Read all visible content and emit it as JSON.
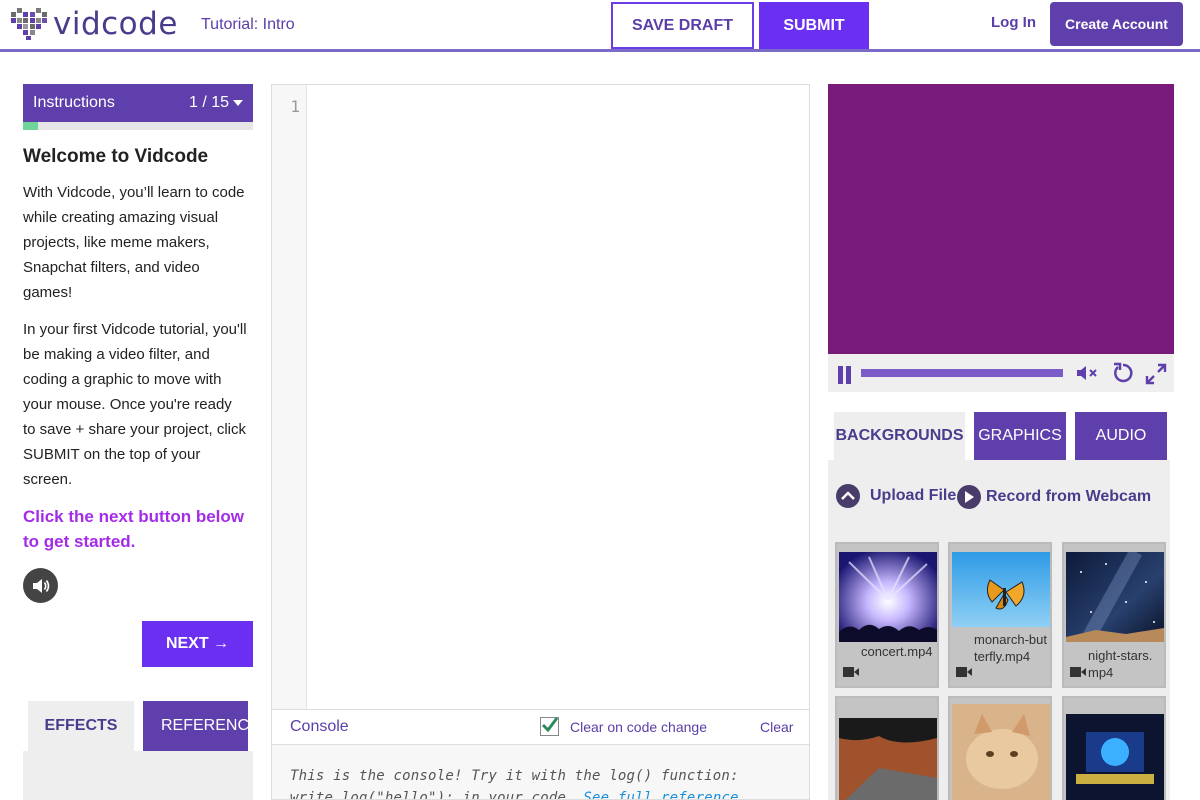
{
  "header": {
    "logo_text": "vidcode",
    "tutorial_title": "Tutorial: Intro",
    "save_draft_label": "SAVE DRAFT",
    "submit_label": "SUBMIT",
    "login_label": "Log In",
    "create_account_label": "Create Account"
  },
  "instructions": {
    "title": "Instructions",
    "counter": "1 / 15",
    "progress": 0.065,
    "heading": "Welcome to Vidcode",
    "paragraph1": "With Vidcode, you’ll learn to code while creating amazing visual projects, like meme makers, Snapchat filters, and video games!",
    "paragraph2": "In your first Vidcode tutorial, you'll be making a video filter, and coding a graphic to move with your mouse. Once you're ready to save + share your project, click SUBMIT on the top of your screen.",
    "cta": "Click the next button below to get started.",
    "next_label": "NEXT →"
  },
  "left_tabs": {
    "effects": "EFFECTS",
    "reference": "REFERENCE"
  },
  "editor": {
    "line_number": "1"
  },
  "console": {
    "label": "Console",
    "clear_on_change_label": "Clear on code change",
    "clear_on_change_checked": true,
    "clear_label": "Clear",
    "text_line1": "This is the console! Try it with the log() function:",
    "text_line2": "write log(\"hello\"); in your code.",
    "link_text": "See full reference"
  },
  "media": {
    "tabs": {
      "backgrounds": "BACKGROUNDS",
      "graphics": "GRAPHICS",
      "audio": "AUDIO"
    },
    "upload_label": "Upload File",
    "record_label": "Record from Webcam",
    "files": [
      {
        "name": "concert.mp4"
      },
      {
        "name": "monarch-butterfly.mp4"
      },
      {
        "name": "night-stars.mp4"
      }
    ]
  },
  "colors": {
    "brand_purple": "#5e3fab",
    "accent_violet": "#6a2ff0",
    "preview_bg": "#771a79",
    "cta_purple": "#a42ce8",
    "progress_green": "#6fd49a"
  }
}
